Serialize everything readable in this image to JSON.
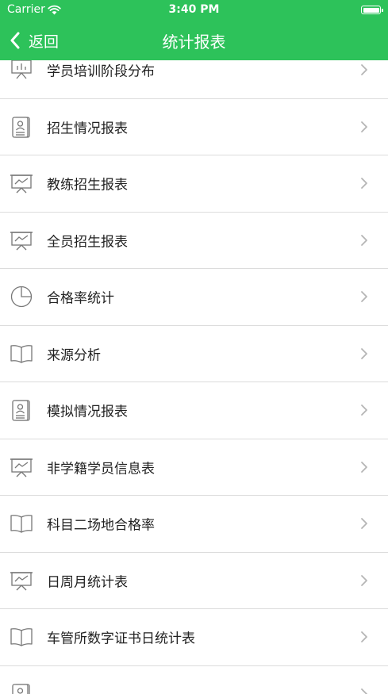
{
  "status_bar": {
    "carrier": "Carrier",
    "time": "3:40 PM"
  },
  "navbar": {
    "back_label": "返回",
    "title": "统计报表",
    "background": "#2dc25a"
  },
  "list": {
    "items": [
      {
        "label": "学员培训阶段分布",
        "icon": "bar-chart-icon"
      },
      {
        "label": "招生情况报表",
        "icon": "contact-card-icon"
      },
      {
        "label": "教练招生报表",
        "icon": "presentation-chart-icon"
      },
      {
        "label": "全员招生报表",
        "icon": "presentation-chart-icon"
      },
      {
        "label": "合格率统计",
        "icon": "pie-chart-icon"
      },
      {
        "label": "来源分析",
        "icon": "book-icon"
      },
      {
        "label": "模拟情况报表",
        "icon": "contact-card-icon"
      },
      {
        "label": "非学籍学员信息表",
        "icon": "presentation-chart-icon"
      },
      {
        "label": "科目二场地合格率",
        "icon": "book-icon"
      },
      {
        "label": "日周月统计表",
        "icon": "presentation-chart-icon"
      },
      {
        "label": "车管所数字证书日统计表",
        "icon": "book-icon"
      },
      {
        "label": "",
        "icon": "contact-card-icon"
      }
    ]
  }
}
